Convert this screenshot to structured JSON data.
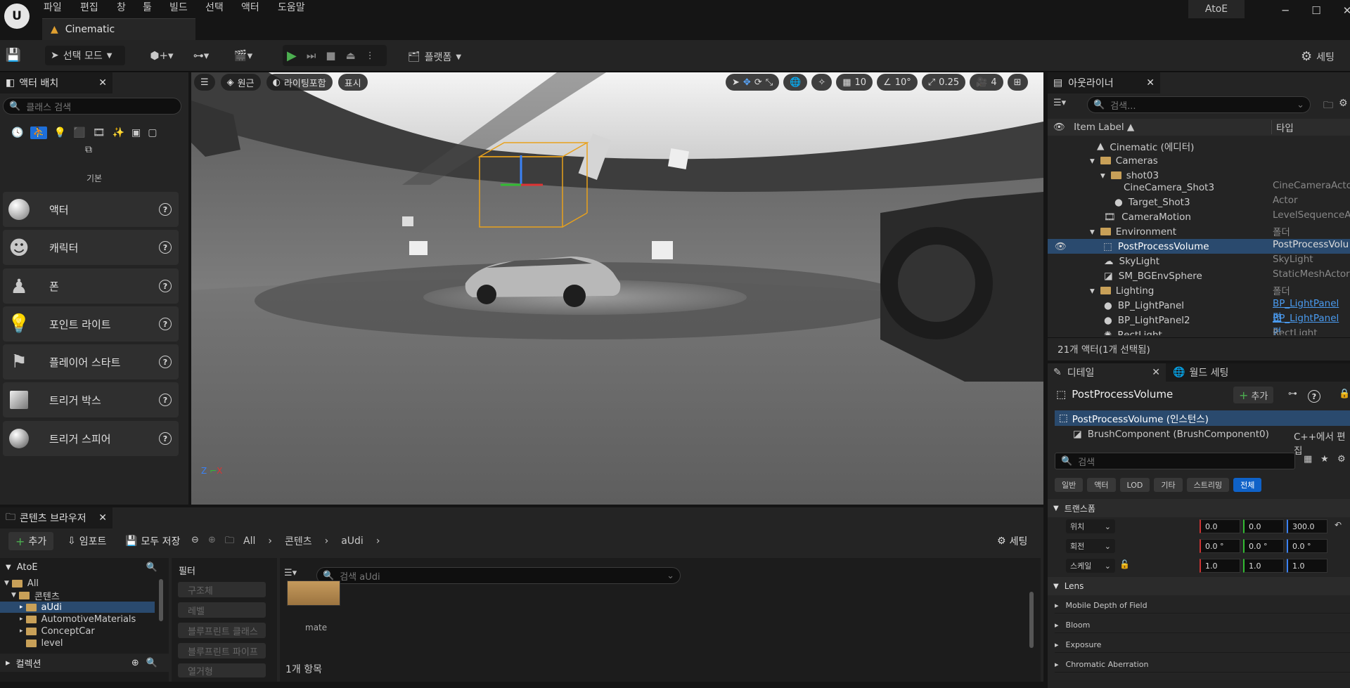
{
  "app": {
    "project": "AtoE",
    "level_tab": "Cinematic"
  },
  "menu": [
    "파일",
    "편집",
    "창",
    "툴",
    "빌드",
    "선택",
    "액터",
    "도움말"
  ],
  "toolbar": {
    "select_mode": "선택 모드",
    "platform": "플랫폼",
    "settings": "세팅"
  },
  "place_actors": {
    "title": "액터 배치",
    "search_placeholder": "클래스 검색",
    "category": "기본",
    "items": [
      {
        "label": "액터",
        "icon": "sphere-icon"
      },
      {
        "label": "캐릭터",
        "icon": "character-icon"
      },
      {
        "label": "폰",
        "icon": "pawn-icon"
      },
      {
        "label": "포인트 라이트",
        "icon": "point-light-icon"
      },
      {
        "label": "플레이어 스타트",
        "icon": "player-start-icon"
      },
      {
        "label": "트리거 박스",
        "icon": "trigger-box-icon"
      },
      {
        "label": "트리거 스피어",
        "icon": "trigger-sphere-icon"
      }
    ]
  },
  "viewport": {
    "perspective": "원근",
    "view_mode": "라이팅포함",
    "show": "표시",
    "grid_snap": "10",
    "rot_snap": "10°",
    "scale_snap": "0.25",
    "camera_speed": "4"
  },
  "outliner": {
    "title": "아웃라이너",
    "search_placeholder": "검색...",
    "col_label": "Item Label ▲",
    "col_type": "타입",
    "rows": [
      {
        "label": "Cinematic (에디터)",
        "type": "",
        "indent": 0
      },
      {
        "label": "Cameras",
        "type": "",
        "indent": 1
      },
      {
        "label": "shot03",
        "type": "",
        "indent": 2
      },
      {
        "label": "CineCamera_Shot3",
        "type": "CineCameraActor",
        "indent": 3
      },
      {
        "label": "Target_Shot3",
        "type": "Actor",
        "indent": 3
      },
      {
        "label": "CameraMotion",
        "type": "LevelSequenceAc",
        "indent": 2
      },
      {
        "label": "Environment",
        "type": "폴더",
        "indent": 1
      },
      {
        "label": "PostProcessVolume",
        "type": "PostProcessVolu",
        "indent": 2
      },
      {
        "label": "SkyLight",
        "type": "SkyLight",
        "indent": 2
      },
      {
        "label": "SM_BGEnvSphere",
        "type": "StaticMeshActor",
        "indent": 2
      },
      {
        "label": "Lighting",
        "type": "폴더",
        "indent": 1
      },
      {
        "label": "BP_LightPanel",
        "type": "BP_LightPanel 편",
        "indent": 2
      },
      {
        "label": "BP_LightPanel2",
        "type": "BP_LightPanel 편",
        "indent": 2
      },
      {
        "label": "RectLight",
        "type": "RectLight",
        "indent": 2
      }
    ],
    "status": "21개 액터(1개 선택됨)"
  },
  "details": {
    "tab": "디테일",
    "world_tab": "월드 세팅",
    "object": "PostProcessVolume",
    "add": "추가",
    "instance": "PostProcessVolume (인스턴스)",
    "component": "BrushComponent (BrushComponent0)",
    "cpp_edit": "C++에서 편집",
    "search_placeholder": "검색",
    "filters": [
      "일반",
      "액터",
      "LOD",
      "기타",
      "스트리밍",
      "전체"
    ],
    "transform_title": "트랜스폼",
    "location": {
      "label": "위치",
      "x": "0.0",
      "y": "0.0",
      "z": "300.0"
    },
    "rotation": {
      "label": "회전",
      "x": "0.0 °",
      "y": "0.0 °",
      "z": "0.0 °"
    },
    "scale": {
      "label": "스케일",
      "x": "1.0",
      "y": "1.0",
      "z": "1.0"
    },
    "lens_title": "Lens",
    "lens_items": [
      "Mobile Depth of Field",
      "Bloom",
      "Exposure",
      "Chromatic Aberration"
    ]
  },
  "content_browser": {
    "title": "콘텐츠 브라우저",
    "add": "추가",
    "import": "임포트",
    "save_all": "모두 저장",
    "path": [
      "All",
      "콘텐츠",
      "aUdi"
    ],
    "settings": "세팅",
    "root": "AtoE",
    "tree": [
      {
        "label": "All",
        "indent": 0
      },
      {
        "label": "콘텐츠",
        "indent": 1
      },
      {
        "label": "aUdi",
        "indent": 2
      },
      {
        "label": "AutomotiveMaterials",
        "indent": 2
      },
      {
        "label": "ConceptCar",
        "indent": 2
      },
      {
        "label": "level",
        "indent": 2
      }
    ],
    "collections": "컬렉션",
    "filters_title": "필터",
    "filter_items": [
      "구조체",
      "레벨",
      "블루프린트 클래스",
      "블루프린트 파이프",
      "열거형"
    ],
    "search_placeholder": "검색 aUdi",
    "asset_label": "mate",
    "item_count": "1개 항목"
  }
}
